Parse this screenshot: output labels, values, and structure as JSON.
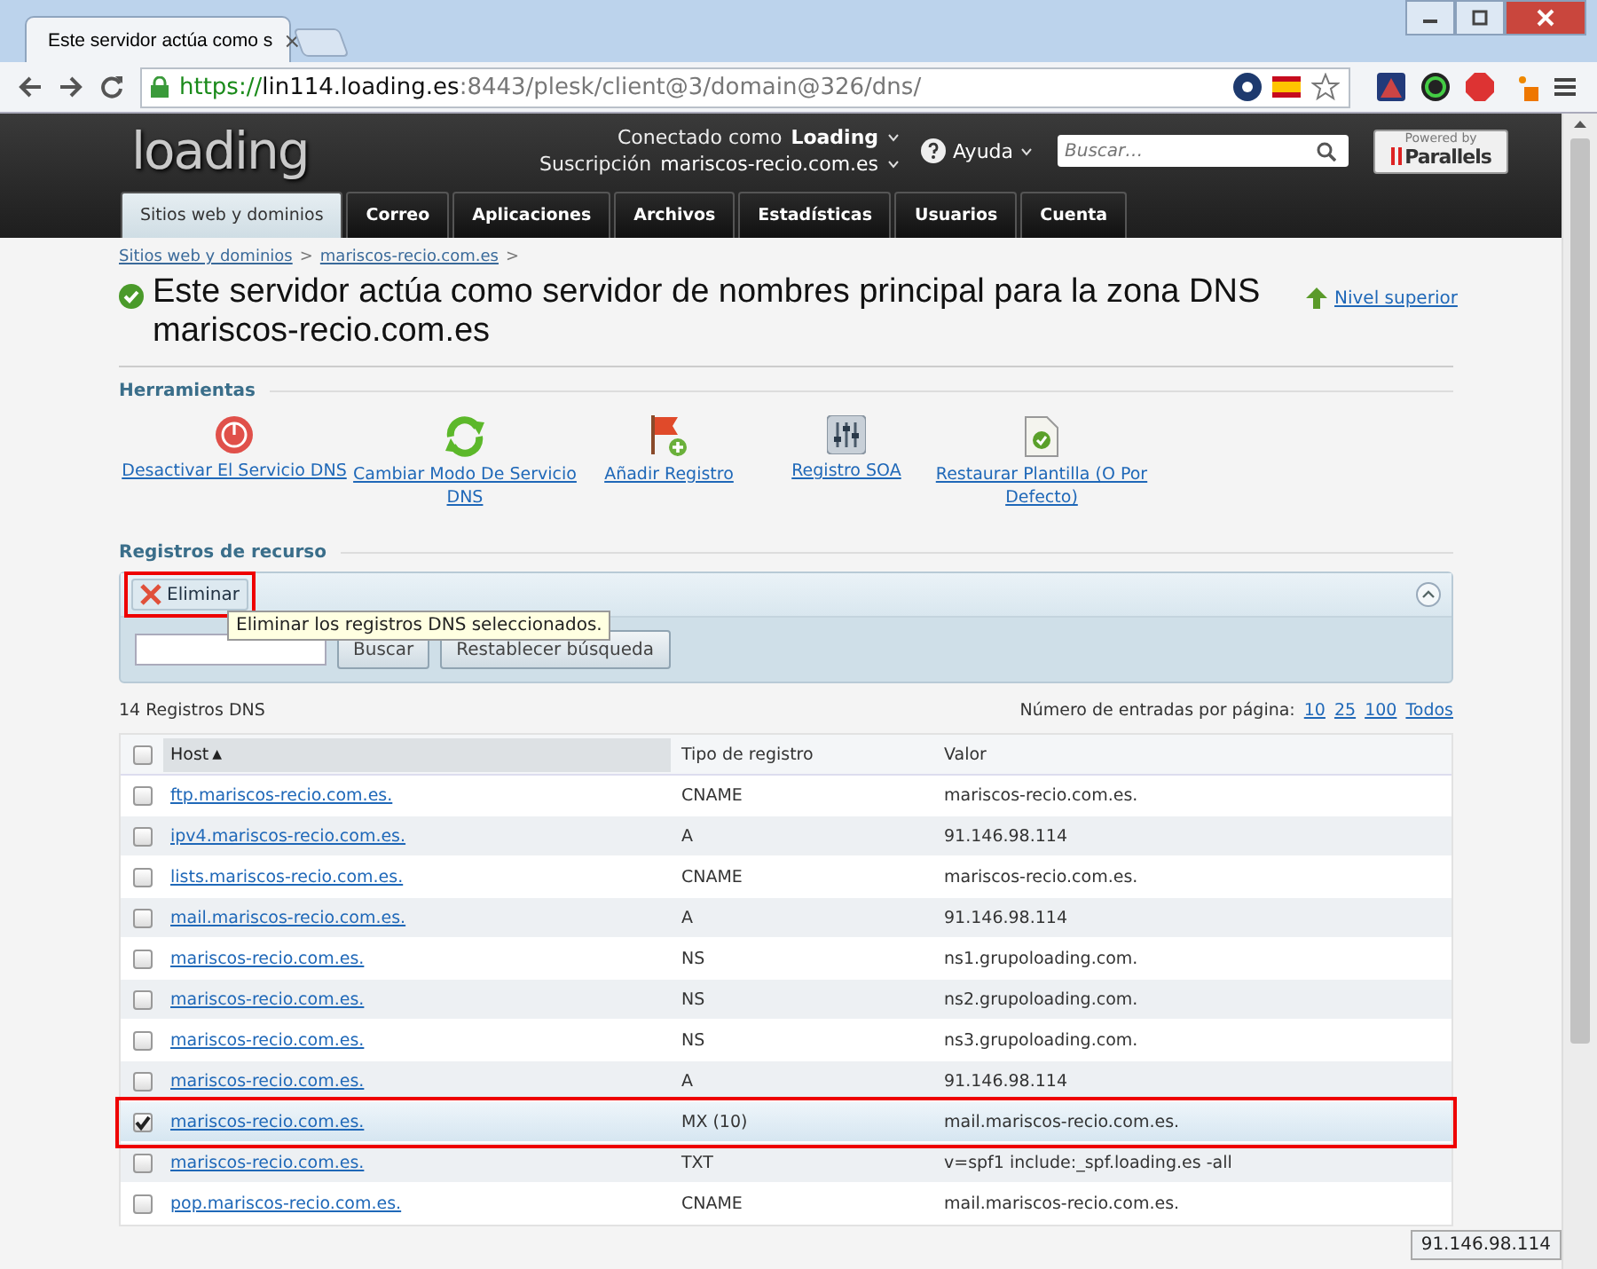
{
  "browser": {
    "tab_title": "Este servidor actúa como s",
    "tab_close": "×",
    "url_scheme": "https://",
    "url_host": "lin114.loading.es",
    "url_rest": ":8443/plesk/client@3/domain@326/dns/"
  },
  "header": {
    "logo": "loading",
    "connected_label": "Conectado como",
    "user": "Loading",
    "subscription_label": "Suscripción",
    "subscription": "mariscos-recio.com.es",
    "help": "Ayuda",
    "search_placeholder": "Buscar…",
    "powered_by": "Powered by",
    "parallels": "Parallels"
  },
  "nav_tabs": [
    {
      "label": "Sitios web y dominios",
      "selected": true
    },
    {
      "label": "Correo",
      "selected": false
    },
    {
      "label": "Aplicaciones",
      "selected": false
    },
    {
      "label": "Archivos",
      "selected": false
    },
    {
      "label": "Estadísticas",
      "selected": false
    },
    {
      "label": "Usuarios",
      "selected": false
    },
    {
      "label": "Cuenta",
      "selected": false
    }
  ],
  "breadcrumbs": [
    "Sitios web y dominios",
    "mariscos-recio.com.es"
  ],
  "breadcrumb_separator": ">",
  "page_title": "Este servidor actúa como servidor de nombres principal para la zona DNS mariscos-recio.com.es",
  "up_link": "Nivel superior",
  "tools": {
    "title": "Herramientas",
    "items": [
      {
        "label": "Desactivar El Servicio DNS",
        "kind": "power"
      },
      {
        "label": "Cambiar Modo De Servicio DNS",
        "kind": "refresh"
      },
      {
        "label": "Añadir Registro",
        "kind": "flag"
      },
      {
        "label": "Registro SOA",
        "kind": "sliders"
      },
      {
        "label": "Restaurar Plantilla (O Por Defecto)",
        "kind": "document"
      }
    ]
  },
  "records": {
    "title": "Registros de recurso",
    "delete_button": {
      "label": "Eliminar",
      "highlighted": true
    },
    "tooltip": "Eliminar los registros DNS seleccionados.",
    "search_buttons": [
      "Buscar",
      "Restablecer búsqueda"
    ],
    "count": "14 Registros DNS",
    "per_page_label": "Número de entradas por página:",
    "per_page_options": [
      "10",
      "25",
      "100",
      "Todos"
    ],
    "columns": [
      "Host",
      "Tipo de registro",
      "Valor"
    ],
    "sort_indicator": "▲",
    "all_selected": false,
    "rows": [
      {
        "host": "ftp.mariscos-recio.com.es.",
        "type": "CNAME",
        "value": "mariscos-recio.com.es.",
        "checked": false,
        "highlighted": false
      },
      {
        "host": "ipv4.mariscos-recio.com.es.",
        "type": "A",
        "value": "91.146.98.114",
        "checked": false,
        "highlighted": false
      },
      {
        "host": "lists.mariscos-recio.com.es.",
        "type": "CNAME",
        "value": "mariscos-recio.com.es.",
        "checked": false,
        "highlighted": false
      },
      {
        "host": "mail.mariscos-recio.com.es.",
        "type": "A",
        "value": "91.146.98.114",
        "checked": false,
        "highlighted": false
      },
      {
        "host": "mariscos-recio.com.es.",
        "type": "NS",
        "value": "ns1.grupoloading.com.",
        "checked": false,
        "highlighted": false
      },
      {
        "host": "mariscos-recio.com.es.",
        "type": "NS",
        "value": "ns2.grupoloading.com.",
        "checked": false,
        "highlighted": false
      },
      {
        "host": "mariscos-recio.com.es.",
        "type": "NS",
        "value": "ns3.grupoloading.com.",
        "checked": false,
        "highlighted": false
      },
      {
        "host": "mariscos-recio.com.es.",
        "type": "A",
        "value": "91.146.98.114",
        "checked": false,
        "highlighted": false
      },
      {
        "host": "mariscos-recio.com.es.",
        "type": "MX (10)",
        "value": "mail.mariscos-recio.com.es.",
        "checked": true,
        "highlighted": true
      },
      {
        "host": "mariscos-recio.com.es.",
        "type": "TXT",
        "value": "v=spf1  include:_spf.loading.es -all",
        "checked": false,
        "highlighted": false
      },
      {
        "host": "pop.mariscos-recio.com.es.",
        "type": "CNAME",
        "value": "mail.mariscos-recio.com.es.",
        "checked": false,
        "highlighted": false
      }
    ]
  },
  "status_url": "91.146.98.114"
}
